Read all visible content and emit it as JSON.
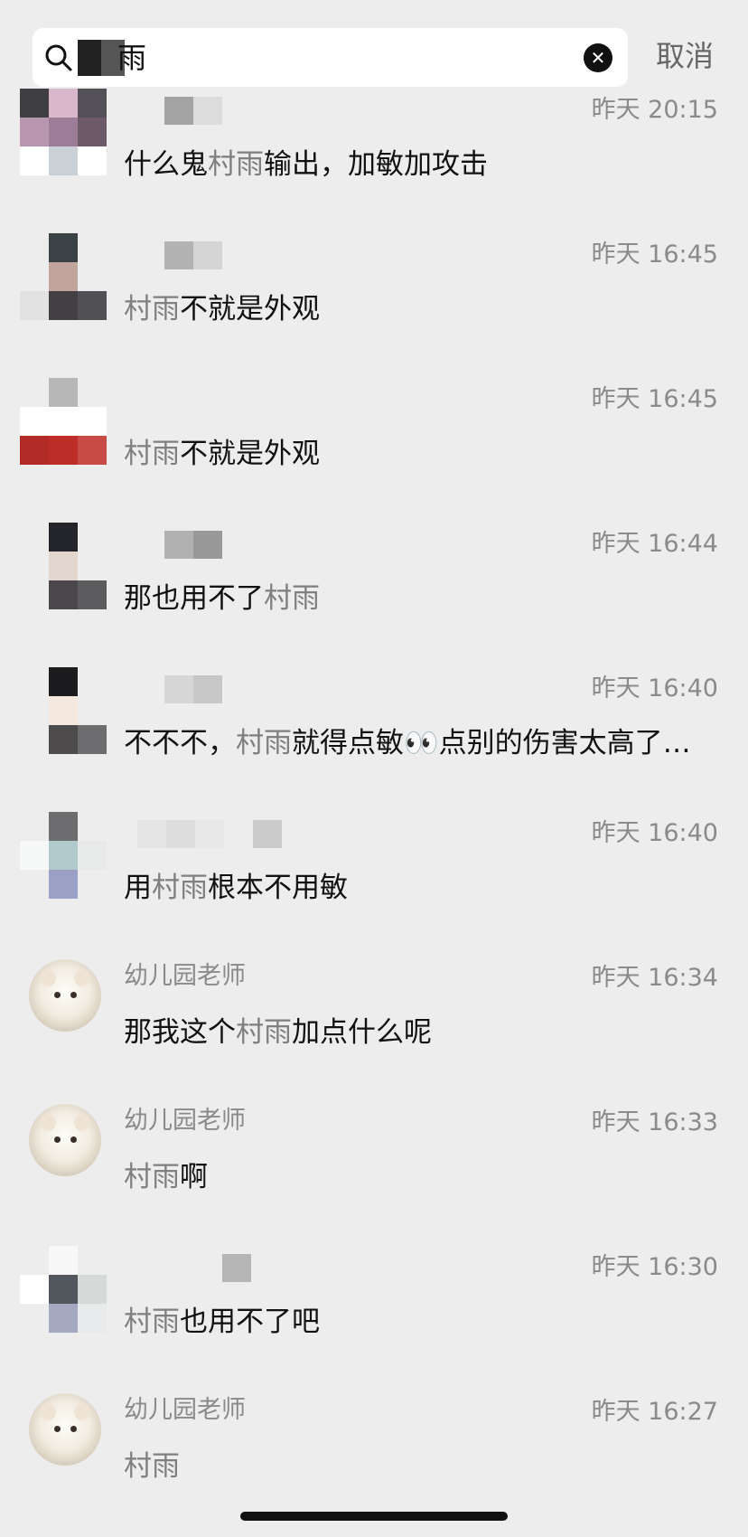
{
  "search": {
    "query": "雨",
    "cancel_label": "取消"
  },
  "messages": [
    {
      "sender": "",
      "time": "昨天 20:15",
      "segments": [
        {
          "text": "什么鬼",
          "highlight": false
        },
        {
          "text": "村雨",
          "highlight": true
        },
        {
          "text": "输出，加敏加攻击",
          "highlight": false
        }
      ]
    },
    {
      "sender": "",
      "time": "昨天 16:45",
      "segments": [
        {
          "text": "村雨",
          "highlight": true
        },
        {
          "text": "不就是外观",
          "highlight": false
        }
      ]
    },
    {
      "sender": "",
      "time": "昨天 16:45",
      "segments": [
        {
          "text": "村雨",
          "highlight": true
        },
        {
          "text": "不就是外观",
          "highlight": false
        }
      ]
    },
    {
      "sender": "",
      "time": "昨天 16:44",
      "segments": [
        {
          "text": "那也用不了",
          "highlight": false
        },
        {
          "text": "村雨",
          "highlight": true
        }
      ]
    },
    {
      "sender": "",
      "time": "昨天 16:40",
      "segments": [
        {
          "text": "不不不，",
          "highlight": false
        },
        {
          "text": "村雨",
          "highlight": true
        },
        {
          "text": "就得点敏👀点别的伤害太高了…",
          "highlight": false
        }
      ]
    },
    {
      "sender": "",
      "time": "昨天 16:40",
      "segments": [
        {
          "text": "用",
          "highlight": false
        },
        {
          "text": "村雨",
          "highlight": true
        },
        {
          "text": "根本不用敏",
          "highlight": false
        }
      ]
    },
    {
      "sender": "幼儿园老师",
      "time": "昨天 16:34",
      "segments": [
        {
          "text": "那我这个",
          "highlight": false
        },
        {
          "text": "村雨",
          "highlight": true
        },
        {
          "text": "加点什么呢",
          "highlight": false
        }
      ]
    },
    {
      "sender": "幼儿园老师",
      "time": "昨天 16:33",
      "segments": [
        {
          "text": "村雨",
          "highlight": true
        },
        {
          "text": "啊",
          "highlight": false
        }
      ]
    },
    {
      "sender": "",
      "time": "昨天 16:30",
      "segments": [
        {
          "text": "村雨",
          "highlight": true
        },
        {
          "text": "也用不了吧",
          "highlight": false
        }
      ]
    },
    {
      "sender": "幼儿园老师",
      "time": "昨天 16:27",
      "segments": [
        {
          "text": "村雨",
          "highlight": true
        }
      ]
    }
  ]
}
